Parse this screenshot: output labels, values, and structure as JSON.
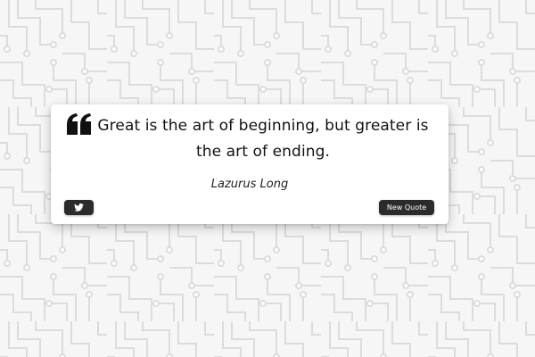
{
  "quote": {
    "text": "Great is the art of beginning, but greater is the art of ending.",
    "author": "Lazurus Long"
  },
  "buttons": {
    "tweet_icon": "twitter-icon",
    "new_quote_label": "New Quote"
  },
  "colors": {
    "background": "#f6f6f6",
    "pattern": "#dcdcdc",
    "card": "#ffffff",
    "button": "#2b2b2b",
    "button_text": "#ffffff"
  }
}
